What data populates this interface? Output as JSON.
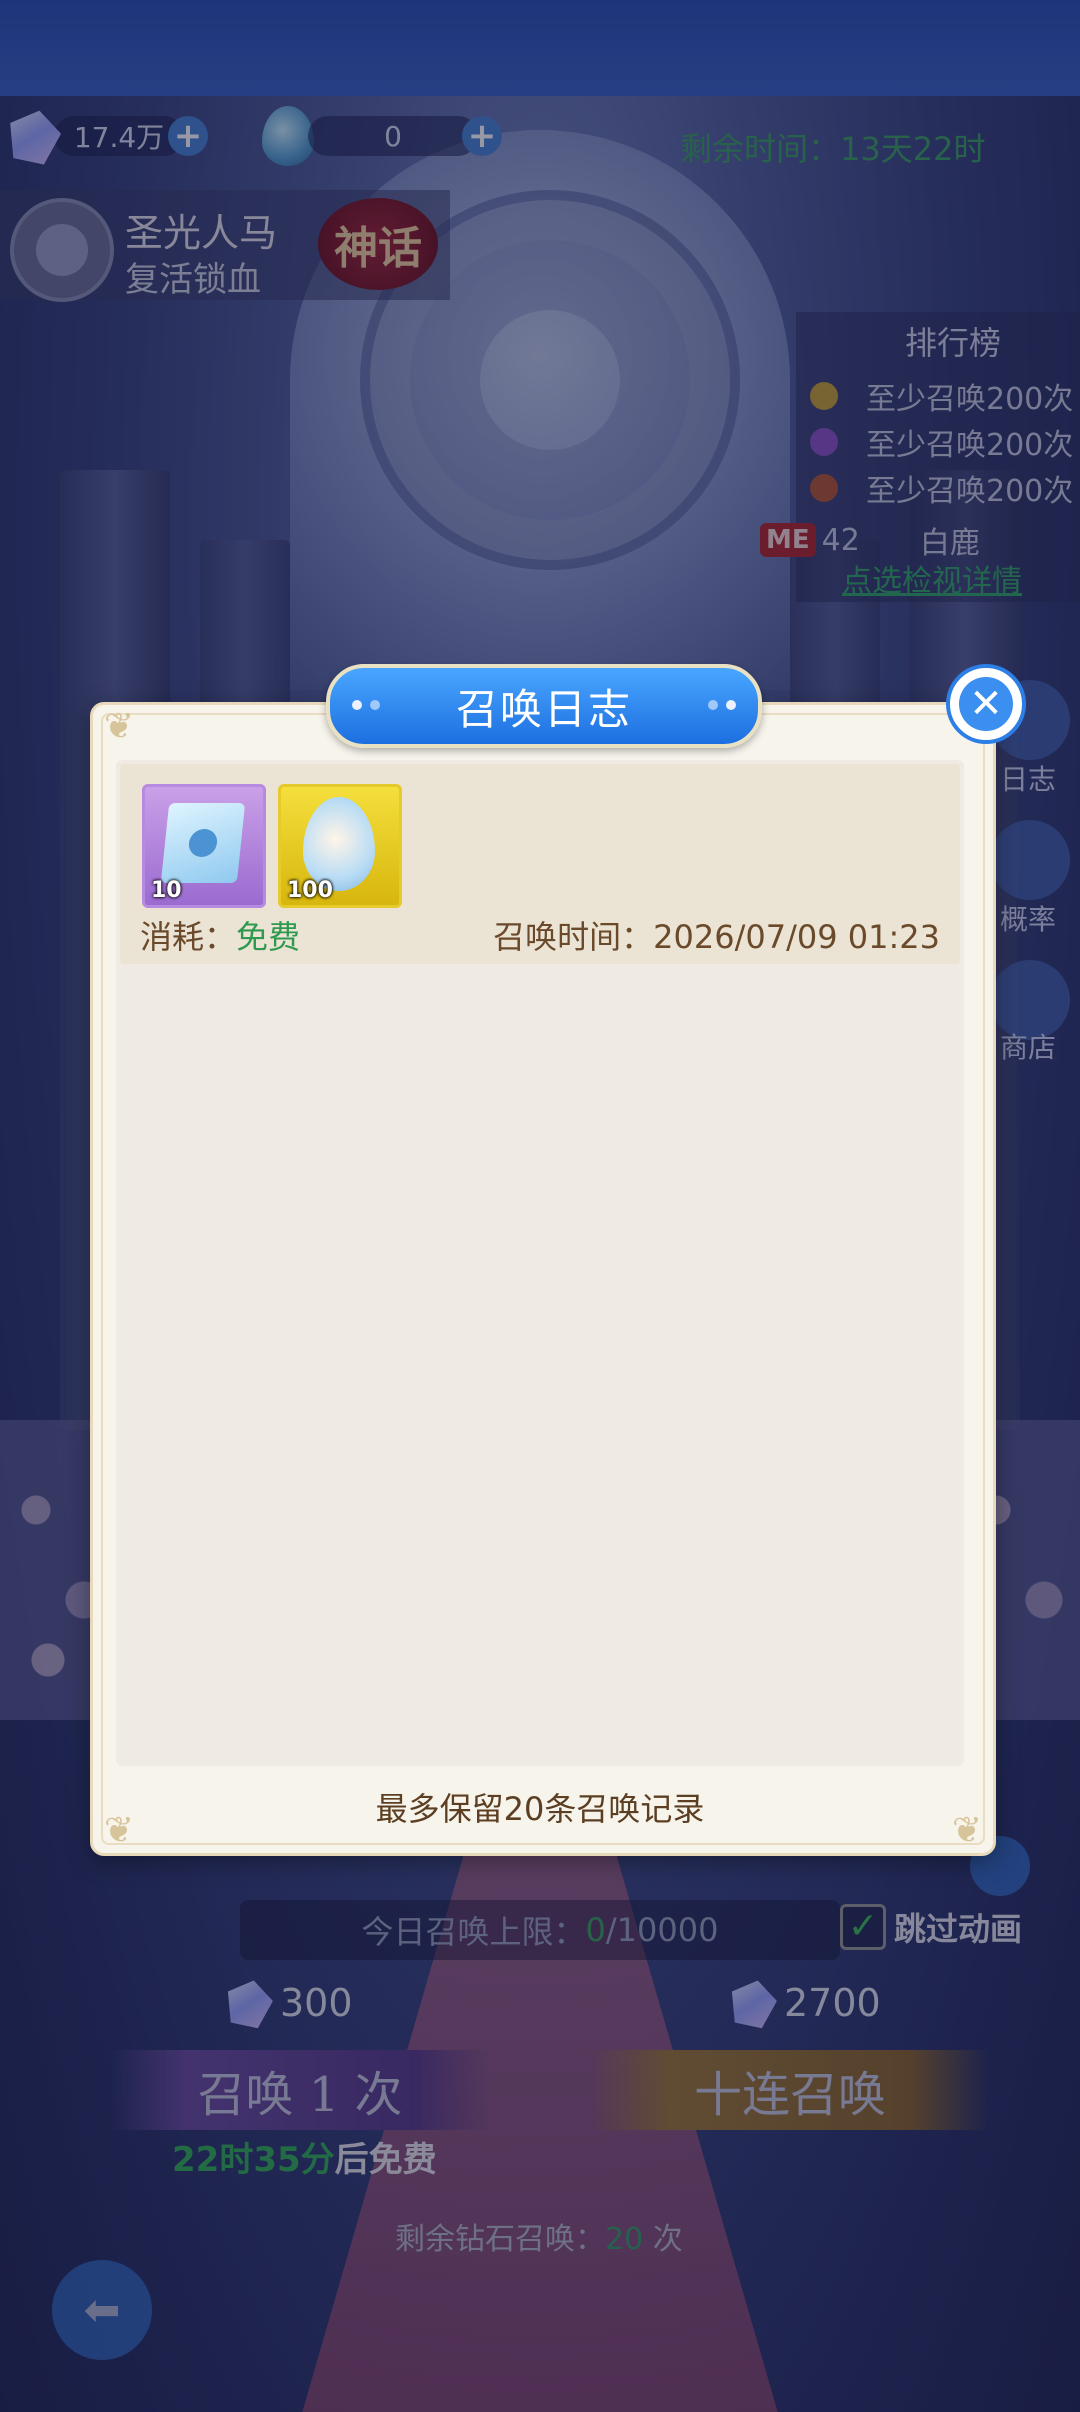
{
  "currency": {
    "diamond": "17.4万",
    "egg": "0"
  },
  "remaining_time": "剩余时间：13天22时",
  "hero": {
    "name": "圣光人马",
    "skill": "复活锁血",
    "tier": "神话"
  },
  "ranking": {
    "title": "排行榜",
    "rows": [
      "至少召唤200次",
      "至少召唤200次",
      "至少召唤200次"
    ],
    "me_badge": "ME",
    "me_rank": "42",
    "me_name": "白鹿",
    "detail_link": "点选检视详情",
    "medal_colors": [
      "#c9a23a",
      "#8f55c9",
      "#b5573a"
    ]
  },
  "side_buttons": [
    "日志",
    "概率",
    "商店"
  ],
  "modal": {
    "title": "召唤日志",
    "close_icon": "close-icon",
    "entries": [
      {
        "items": [
          {
            "icon": "book-icon",
            "count": "10"
          },
          {
            "icon": "egg-icon",
            "count": "100"
          }
        ],
        "cost_label": "消耗：",
        "cost_value": "免费",
        "time_label": "召唤时间：2026/07/09 01:23"
      }
    ],
    "footer_note": "最多保留20条召唤记录"
  },
  "bottom": {
    "daily_limit_prefix": "今日召唤上限：",
    "daily_limit_current": "0",
    "daily_limit_max": "/10000",
    "skip_animation": "跳过动画",
    "skip_checked": true,
    "cost_single": "300",
    "cost_ten": "2700",
    "summon_single": "召唤 1 次",
    "summon_ten": "十连召唤",
    "free_countdown": "22时35分",
    "free_suffix": "后免费",
    "remain_diamond_prefix": "剩余钻石召唤：",
    "remain_diamond_count": "20",
    "remain_diamond_suffix": " 次"
  },
  "colors": {
    "accent_blue": "#1d6fe0",
    "green_text": "#2f9a4f",
    "modal_bg": "#f7f4ec",
    "brown_text": "#6a4a2a"
  }
}
